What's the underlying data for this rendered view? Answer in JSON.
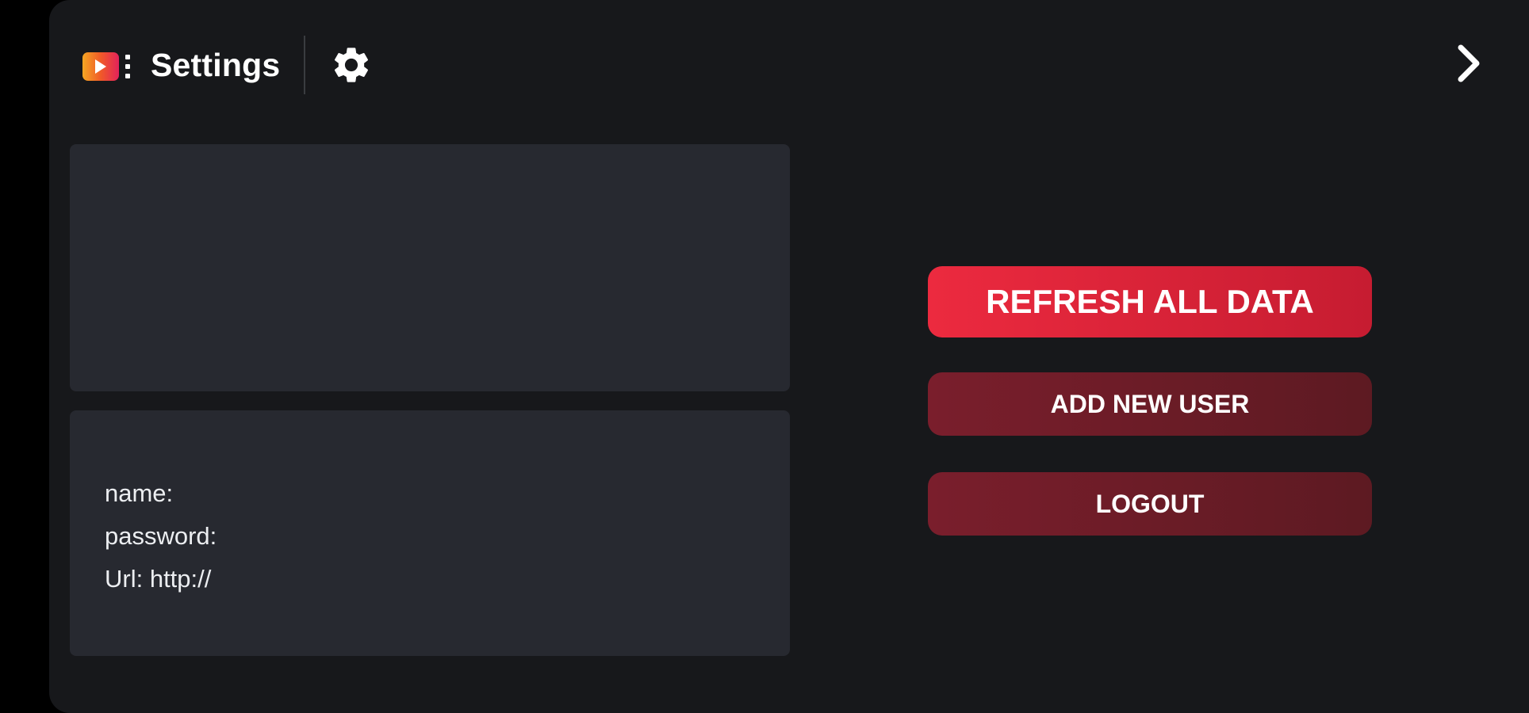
{
  "header": {
    "title": "Settings",
    "logo_icon": "video-player-icon",
    "settings_icon": "gear-icon",
    "next_icon": "chevron-right-icon"
  },
  "account_info": {
    "name_line": "name:",
    "password_line": "password:",
    "url_line": "Url: http://"
  },
  "actions": {
    "refresh_label": "REFRESH ALL DATA",
    "add_user_label": "ADD NEW USER",
    "logout_label": "LOGOUT"
  },
  "colors": {
    "background": "#17181b",
    "card": "#272930",
    "primary_button": "#e3233a",
    "secondary_button": "#6d1c28",
    "logo_gradient": [
      "#f5a623",
      "#f05a28",
      "#e3225b"
    ]
  }
}
